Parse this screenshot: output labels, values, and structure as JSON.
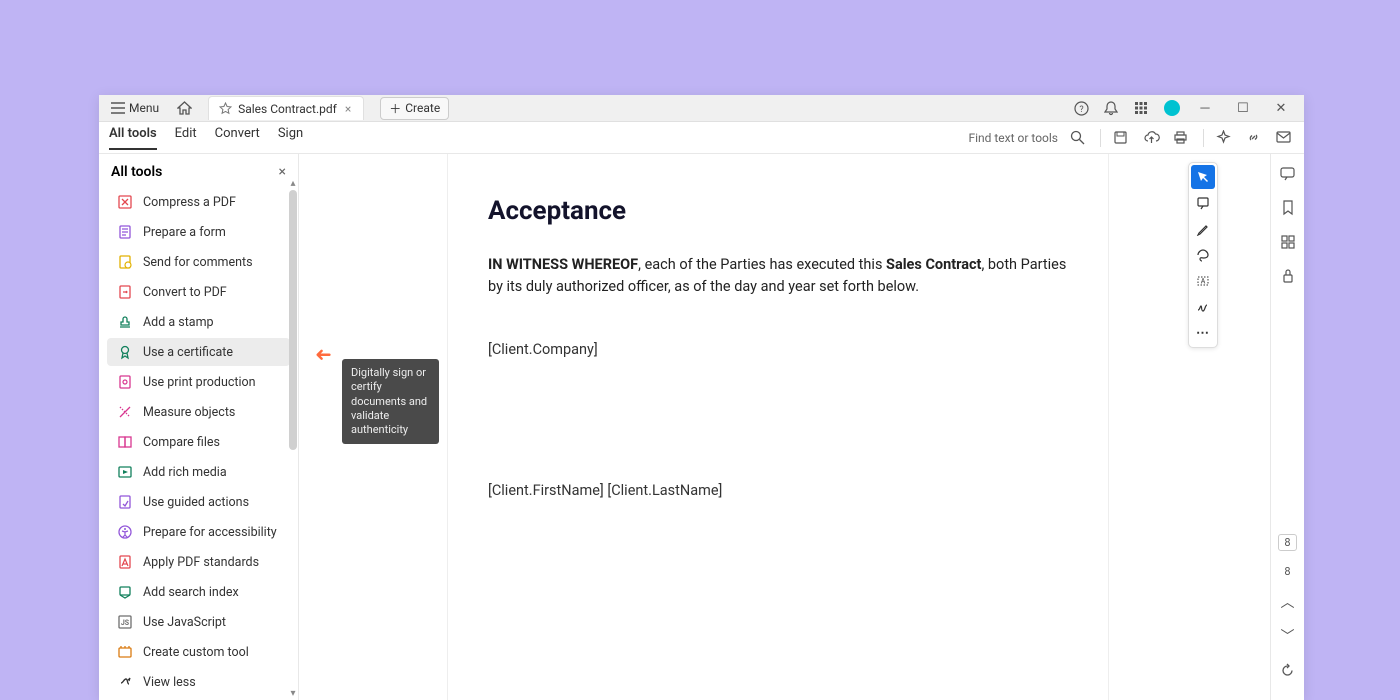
{
  "titlebar": {
    "menu_label": "Menu",
    "tab_title": "Sales Contract.pdf",
    "create_label": "Create"
  },
  "toolbar": {
    "tabs": [
      "All tools",
      "Edit",
      "Convert",
      "Sign"
    ],
    "search_label": "Find text or tools"
  },
  "sidebar": {
    "title": "All tools",
    "items": [
      {
        "label": "Compress a PDF",
        "icon": "compress",
        "color": "#e34850"
      },
      {
        "label": "Prepare a form",
        "icon": "form",
        "color": "#9256d9"
      },
      {
        "label": "Send for comments",
        "icon": "send-comments",
        "color": "#e2b100"
      },
      {
        "label": "Convert to PDF",
        "icon": "convert",
        "color": "#e34850"
      },
      {
        "label": "Add a stamp",
        "icon": "stamp",
        "color": "#12805c"
      },
      {
        "label": "Use a certificate",
        "icon": "certificate",
        "color": "#12805c"
      },
      {
        "label": "Use print production",
        "icon": "print-production",
        "color": "#d83790"
      },
      {
        "label": "Measure objects",
        "icon": "measure",
        "color": "#d83790"
      },
      {
        "label": "Compare files",
        "icon": "compare",
        "color": "#d83790"
      },
      {
        "label": "Add rich media",
        "icon": "rich-media",
        "color": "#12805c"
      },
      {
        "label": "Use guided actions",
        "icon": "guided",
        "color": "#9256d9"
      },
      {
        "label": "Prepare for accessibility",
        "icon": "accessibility",
        "color": "#9256d9"
      },
      {
        "label": "Apply PDF standards",
        "icon": "standards",
        "color": "#e34850"
      },
      {
        "label": "Add search index",
        "icon": "search-index",
        "color": "#12805c"
      },
      {
        "label": "Use JavaScript",
        "icon": "javascript",
        "color": "#6e6e6e"
      },
      {
        "label": "Create custom tool",
        "icon": "custom-tool",
        "color": "#da7b11"
      },
      {
        "label": "View less",
        "icon": "view-less",
        "color": "#333"
      }
    ],
    "tooltip": "Digitally sign or certify documents and validate authenticity"
  },
  "document": {
    "heading": "Acceptance",
    "para_pre": "IN WITNESS WHEREOF",
    "para_mid1": ", each of the Parties has executed this ",
    "para_bold2": "Sales Contract",
    "para_mid2": ", both Parties by its duly authorized officer, as of the day and year set forth below.",
    "field1": "[Client.Company]",
    "field2": "[Client.FirstName] [Client.LastName]"
  },
  "rightbar": {
    "page_current": "8",
    "page_total": "8"
  }
}
